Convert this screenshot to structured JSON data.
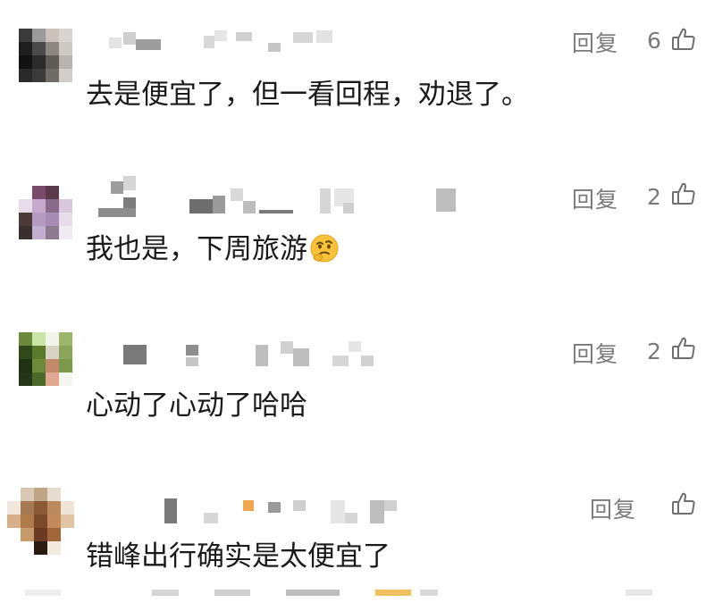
{
  "comments": [
    {
      "reply_label": "回复",
      "likes": "6",
      "text": "去是便宜了，但一看回程，劝退了。"
    },
    {
      "reply_label": "回复",
      "likes": "2",
      "text": "我也是，下周旅游",
      "emoji": "thinking-face"
    },
    {
      "reply_label": "回复",
      "likes": "2",
      "text": "心动了心动了哈哈"
    },
    {
      "reply_label": "回复",
      "likes": "",
      "text": "错峰出行确实是太便宜了"
    }
  ],
  "colors": {
    "text": "#1a1a1a",
    "meta": "#7a7a7a",
    "background": "#ffffff"
  },
  "icons": {
    "like": "thumbs-up-outline-icon",
    "emoji": "thinking-face-emoji"
  }
}
